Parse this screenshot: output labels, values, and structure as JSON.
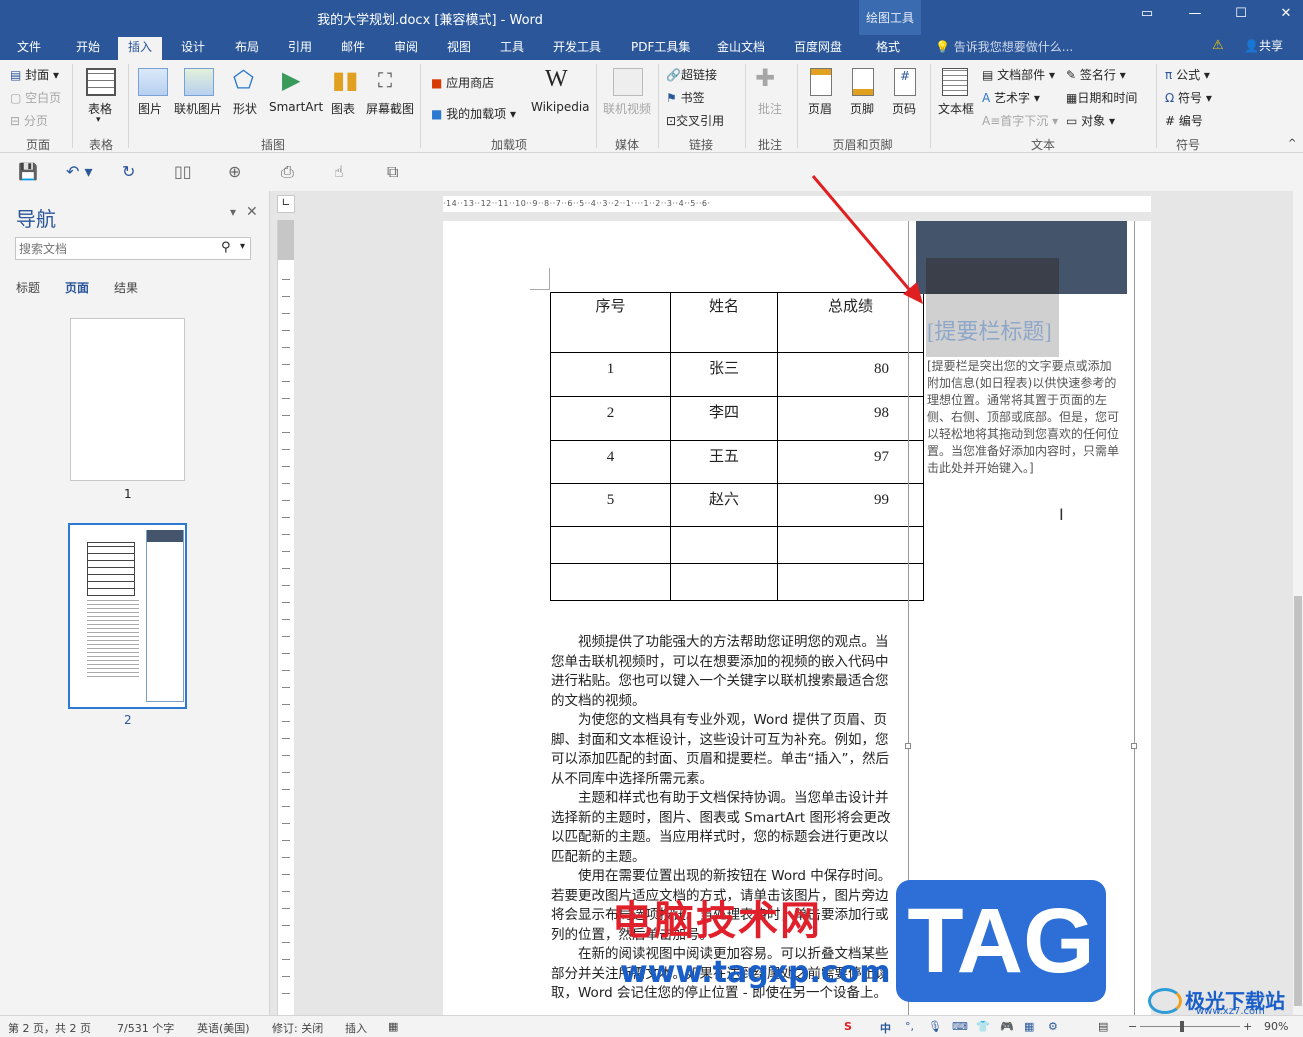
{
  "window": {
    "title": "我的大学规划.docx [兼容模式] - Word",
    "context_tab_group": "绘图工具"
  },
  "tabs": [
    "文件",
    "开始",
    "插入",
    "设计",
    "布局",
    "引用",
    "邮件",
    "审阅",
    "视图",
    "工具",
    "开发工具",
    "PDF工具集",
    "金山文档",
    "百度网盘",
    "格式"
  ],
  "active_tab": "插入",
  "tell_me": "告诉我您想要做什么...",
  "share": "共享",
  "ribbon": {
    "page": {
      "cover": "封面",
      "blank": "空白页",
      "break": "分页",
      "group": "页面"
    },
    "table": {
      "table": "表格",
      "group": "表格"
    },
    "illustrations": {
      "picture": "图片",
      "online_picture": "联机图片",
      "shapes": "形状",
      "smartart": "SmartArt",
      "chart": "图表",
      "screenshot": "屏幕截图",
      "group": "插图"
    },
    "addins": {
      "store": "应用商店",
      "my_addins": "我的加载项",
      "wikipedia": "Wikipedia",
      "group": "加载项"
    },
    "media": {
      "online_video": "联机视频",
      "group": "媒体"
    },
    "links": {
      "hyperlink": "超链接",
      "bookmark": "书签",
      "cross_ref": "交叉引用",
      "group": "链接"
    },
    "comments": {
      "comment": "批注",
      "group": "批注"
    },
    "header_footer": {
      "header": "页眉",
      "footer": "页脚",
      "page_number": "页码",
      "group": "页眉和页脚"
    },
    "text": {
      "textbox": "文本框",
      "quick_parts": "文档部件",
      "wordart": "艺术字",
      "dropcap": "首字下沉",
      "signature": "签名行",
      "datetime": "日期和时间",
      "object": "对象",
      "group": "文本"
    },
    "symbols": {
      "equation": "公式",
      "symbol": "符号",
      "number": "编号",
      "group": "符号"
    }
  },
  "nav": {
    "title": "导航",
    "search_placeholder": "搜索文档",
    "tabs": [
      "标题",
      "页面",
      "结果"
    ],
    "active_tab": "页面",
    "thumbs": [
      "1",
      "2"
    ]
  },
  "ruler_text": "·14··13··12··11··10··9··8··7··6··5··4··3··2··1····1··2··3··4··5··6·",
  "table": {
    "headers": [
      "序号",
      "姓名",
      "总成绩"
    ],
    "rows": [
      [
        "1",
        "张三",
        "80"
      ],
      [
        "2",
        "李四",
        "98"
      ],
      [
        "4",
        "王五",
        "97"
      ],
      [
        "5",
        "赵六",
        "99"
      ],
      [
        "",
        "",
        ""
      ],
      [
        "",
        "",
        ""
      ]
    ]
  },
  "sidebar": {
    "title": "[提要栏标题]",
    "text": "[提要栏是突出您的文字要点或添加附加信息(如日程表)以供快速参考的理想位置。通常将其置于页面的左侧、右侧、顶部或底部。但是，您可以轻松地将其拖动到您喜欢的任何位置。当您准备好添加内容时，只需单击此处并开始键入。]"
  },
  "body_paragraphs": [
    "视频提供了功能强大的方法帮助您证明您的观点。当您单击联机视频时，可以在想要添加的视频的嵌入代码中进行粘贴。您也可以键入一个关键字以联机搜索最适合您的文档的视频。",
    "为使您的文档具有专业外观，Word 提供了页眉、页脚、封面和文本框设计，这些设计可互为补充。例如，您可以添加匹配的封面、页眉和提要栏。单击“插入”，然后从不同库中选择所需元素。",
    "主题和样式也有助于文档保持协调。当您单击设计并选择新的主题时，图片、图表或 SmartArt 图形将会更改以匹配新的主题。当应用样式时，您的标题会进行更改以匹配新的主题。",
    "使用在需要位置出现的新按钮在 Word 中保存时间。若要更改图片适应文档的方式，请单击该图片，图片旁边将会显示布局选项按钮。当处理表格时，单击要添加行或列的位置，然后单击加号。",
    "在新的阅读视图中阅读更加容易。可以折叠文档某些部分并关注所需文本。如果在达到结尾处之前需要停止读取，Word 会记住您的停止位置 - 即使在另一个设备上。"
  ],
  "status": {
    "page": "第 2 页，共 2 页",
    "words": "7/531 个字",
    "lang": "英语(美国)",
    "track": "修订: 关闭",
    "mode": "插入",
    "zoom": "90%"
  },
  "watermark": {
    "site_name": "电脑技术网",
    "url": "www.tagxp.com",
    "badge": "TAG",
    "corner_name": "极光下载站",
    "corner_url": "www.xz7.com"
  },
  "colors": {
    "accent": "#2b579a",
    "sidebar_dark": "#44546a",
    "arrow": "#e02020"
  }
}
